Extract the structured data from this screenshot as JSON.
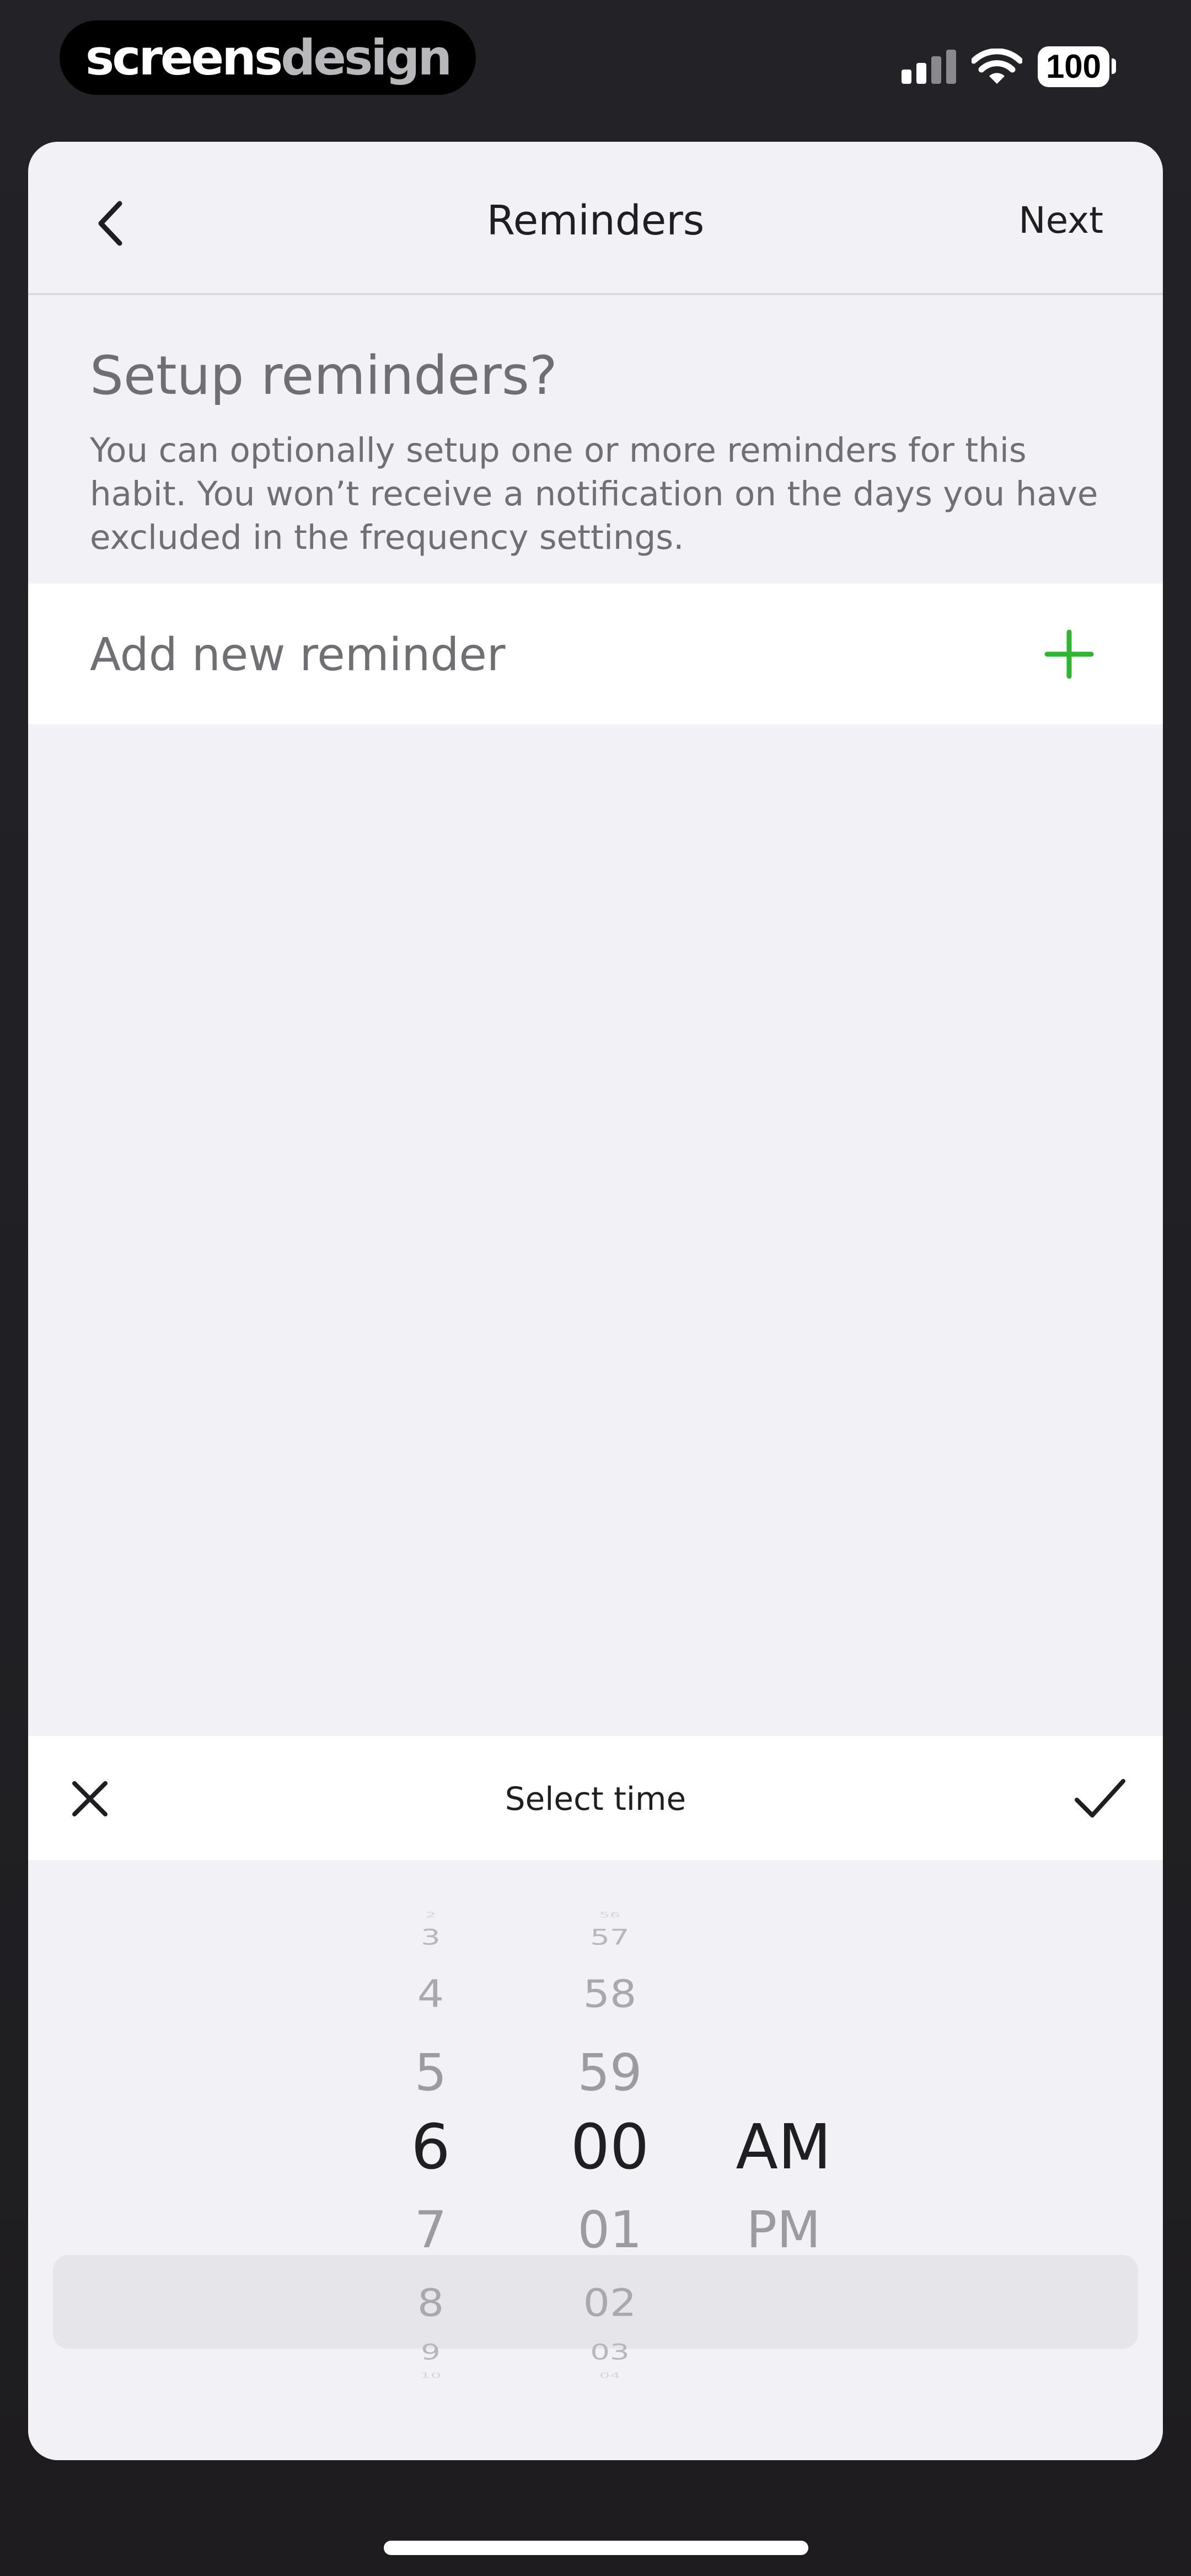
{
  "status_bar": {
    "brand_part1": "screens",
    "brand_part2": "design",
    "battery_level": "100"
  },
  "nav": {
    "title": "Reminders",
    "next_label": "Next"
  },
  "section": {
    "heading": "Setup reminders?",
    "description": "You can optionally setup one or more reminders for this habit. You won’t receive a notification on the days you have excluded in the frequency settings."
  },
  "add_reminder": {
    "label": "Add new reminder",
    "accent_color": "#2fb52f"
  },
  "time_picker": {
    "title": "Select time",
    "hours": [
      "2",
      "3",
      "4",
      "5",
      "6",
      "7",
      "8",
      "9",
      "10"
    ],
    "minutes": [
      "56",
      "57",
      "58",
      "59",
      "00",
      "01",
      "02",
      "03",
      "04"
    ],
    "periods": [
      "AM",
      "PM"
    ],
    "selected": {
      "hour": "6",
      "minute": "00",
      "period": "AM"
    }
  }
}
